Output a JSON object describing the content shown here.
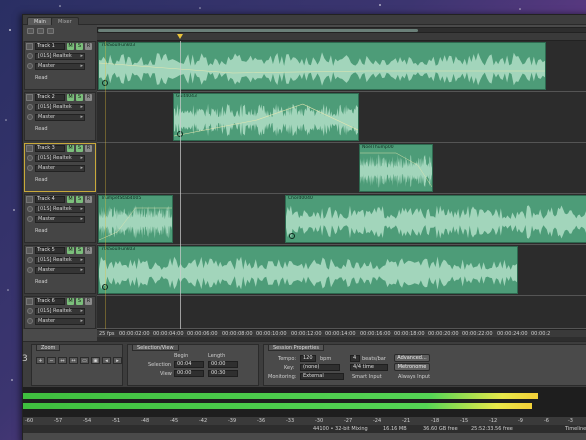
{
  "workspace_tabs": [
    "Main",
    "Mixer"
  ],
  "tracks": [
    {
      "name": "Track 1",
      "input": "[01S] Realtek",
      "output": "Master",
      "automation": "Read",
      "selected": false
    },
    {
      "name": "Track 2",
      "input": "[01S] Realtek",
      "output": "Master",
      "automation": "Read",
      "selected": false
    },
    {
      "name": "Track 3",
      "input": "[01S] Realtek",
      "output": "Master",
      "automation": "Read",
      "selected": true
    },
    {
      "name": "Track 4",
      "input": "[01S] Realtek",
      "output": "Master",
      "automation": "Read",
      "selected": false
    },
    {
      "name": "Track 5",
      "input": "[01S] Realtek",
      "output": "Master",
      "automation": "Read",
      "selected": false
    },
    {
      "name": "Track 6",
      "input": "[01S] Realtek",
      "output": "Master",
      "automation": "Read",
      "selected": false
    }
  ],
  "track_buttons": {
    "mute": "M",
    "solo": "S",
    "record": "R"
  },
  "clips": [
    {
      "title": "70sSoulFunk03"
    },
    {
      "title": "Guit4043"
    },
    {
      "title": "NoelThump00"
    },
    {
      "title": "TrumpetStab4005"
    },
    {
      "title": "Chord0040"
    },
    {
      "title": "70sSoulFunk03"
    }
  ],
  "timeline": {
    "fps": "25 fps",
    "labels": [
      "00:00:02:00",
      "00:00:04:00",
      "00:00:06:00",
      "00:00:08:00",
      "00:00:10:00",
      "00:00:12:00",
      "00:00:14:00",
      "00:00:16:00",
      "00:00:18:00",
      "00:00:20:00",
      "00:00:22:00",
      "00:00:24:00",
      "00:00:2"
    ]
  },
  "zoom_panel": {
    "title": "Zoom"
  },
  "selection_panel": {
    "title": "Selection/View",
    "begin_label": "Begin",
    "length_label": "Length",
    "selection_label": "Selection",
    "view_label": "View",
    "selection_begin": "00:04",
    "selection_length": "00:00",
    "view_begin": "00:00",
    "view_length": "00:30"
  },
  "session_panel": {
    "title": "Session Properties",
    "tempo_label": "Tempo:",
    "tempo_value": "120",
    "bpm_label": "bpm",
    "beats_value": "4",
    "beats_label": "beats/bar",
    "advanced_label": "Advanced...",
    "key_label": "Key:",
    "key_value": "(none)",
    "time_value": "4/4 time",
    "metronome_label": "Metronome",
    "monitoring_label": "Monitoring:",
    "monitoring_value": "External",
    "smart_input_label": "Smart Input",
    "always_input_label": "Always Input"
  },
  "left_counter": "3",
  "meter_scale": [
    "-60",
    "-57",
    "-54",
    "-51",
    "-48",
    "-45",
    "-42",
    "-39",
    "-36",
    "-33",
    "-30",
    "-27",
    "-24",
    "-21",
    "-18",
    "-15",
    "-12",
    "-9",
    "-6",
    "-3"
  ],
  "status": {
    "format": "44100 • 32-bit Mixing",
    "memory": "16.16 MB",
    "disk": "36.60 GB free",
    "duration": "25:52:33.56 free",
    "extra": "Timeline"
  },
  "colors": {
    "clip": "#4d9c78",
    "selected_track": "#c9a93a",
    "playhead": "#e8c23a",
    "meter_green": "#55d455",
    "meter_yellow": "#e8e84a"
  }
}
